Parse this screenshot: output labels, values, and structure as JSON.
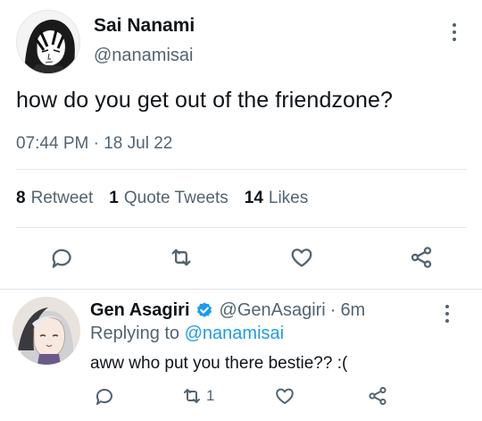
{
  "tweet": {
    "author_name": "Sai Nanami",
    "author_handle": "@nanamisai",
    "text": "how do you get out of the friendzone?",
    "timestamp": "07:44 PM · 18 Jul 22",
    "stats": {
      "retweets_count": "8",
      "retweets_label": "Retweet",
      "quotes_count": "1",
      "quotes_label": "Quote Tweets",
      "likes_count": "14",
      "likes_label": "Likes"
    },
    "actions": [
      "reply-icon",
      "retweet-icon",
      "like-heart-icon",
      "share-icon"
    ]
  },
  "reply": {
    "author_name": "Gen Asagiri",
    "author_handle": "@GenAsagiri",
    "separator": "·",
    "time_ago": "6m",
    "replying_prefix": "Replying to",
    "replying_to": "@nanamisai",
    "text": "aww who put you there bestie?? :(",
    "retweet_count": "1",
    "verified_color": "#1d9bf0"
  },
  "colors": {
    "text_primary": "#0f1419",
    "text_secondary": "#536471",
    "link": "#1d9bf0",
    "divider": "#e1e6ea"
  }
}
